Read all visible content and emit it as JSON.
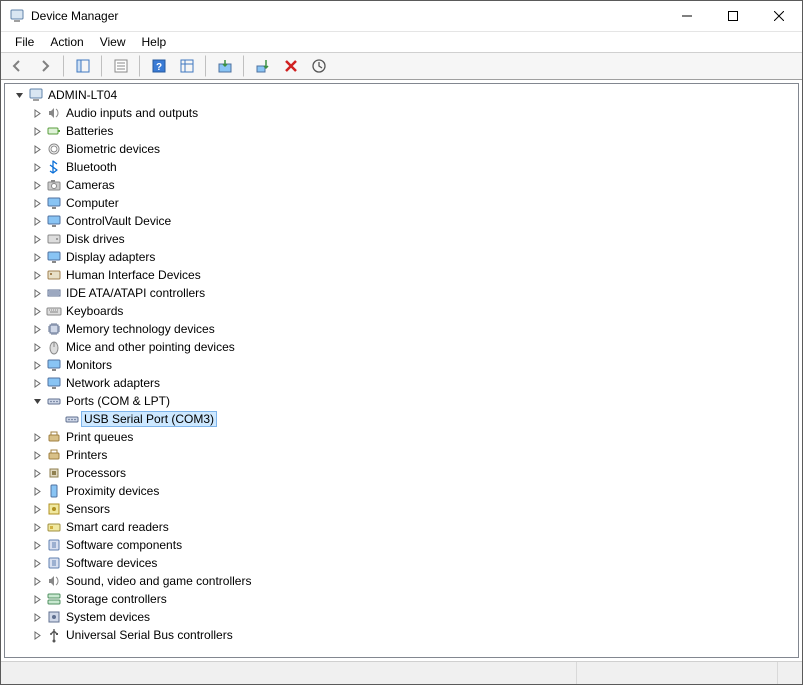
{
  "window": {
    "title": "Device Manager"
  },
  "menu": {
    "file": "File",
    "action": "Action",
    "view": "View",
    "help": "Help"
  },
  "root": {
    "name": "ADMIN-LT04"
  },
  "categories": [
    {
      "id": "audio",
      "label": "Audio inputs and outputs",
      "icon": "speaker"
    },
    {
      "id": "batteries",
      "label": "Batteries",
      "icon": "battery"
    },
    {
      "id": "biometric",
      "label": "Biometric devices",
      "icon": "fingerprint"
    },
    {
      "id": "bluetooth",
      "label": "Bluetooth",
      "icon": "bluetooth"
    },
    {
      "id": "cameras",
      "label": "Cameras",
      "icon": "camera"
    },
    {
      "id": "computer",
      "label": "Computer",
      "icon": "monitor"
    },
    {
      "id": "cvault",
      "label": "ControlVault Device",
      "icon": "monitor"
    },
    {
      "id": "disk",
      "label": "Disk drives",
      "icon": "disk"
    },
    {
      "id": "display",
      "label": "Display adapters",
      "icon": "monitor"
    },
    {
      "id": "hid",
      "label": "Human Interface Devices",
      "icon": "hid"
    },
    {
      "id": "ide",
      "label": "IDE ATA/ATAPI controllers",
      "icon": "ide"
    },
    {
      "id": "keyboards",
      "label": "Keyboards",
      "icon": "keyboard"
    },
    {
      "id": "memory",
      "label": "Memory technology devices",
      "icon": "chip"
    },
    {
      "id": "mice",
      "label": "Mice and other pointing devices",
      "icon": "mouse"
    },
    {
      "id": "monitors",
      "label": "Monitors",
      "icon": "monitor"
    },
    {
      "id": "network",
      "label": "Network adapters",
      "icon": "monitor"
    },
    {
      "id": "ports",
      "label": "Ports (COM & LPT)",
      "icon": "port",
      "expanded": true,
      "children": [
        {
          "id": "usbserial",
          "label": "USB Serial Port (COM3)",
          "icon": "port",
          "selected": true
        }
      ]
    },
    {
      "id": "printq",
      "label": "Print queues",
      "icon": "printer"
    },
    {
      "id": "printers",
      "label": "Printers",
      "icon": "printer"
    },
    {
      "id": "cpu",
      "label": "Processors",
      "icon": "cpu"
    },
    {
      "id": "proximity",
      "label": "Proximity devices",
      "icon": "phone"
    },
    {
      "id": "sensors",
      "label": "Sensors",
      "icon": "sensor"
    },
    {
      "id": "smartcard",
      "label": "Smart card readers",
      "icon": "card"
    },
    {
      "id": "swcomp",
      "label": "Software components",
      "icon": "software"
    },
    {
      "id": "swdev",
      "label": "Software devices",
      "icon": "software"
    },
    {
      "id": "sound",
      "label": "Sound, video and game controllers",
      "icon": "speaker"
    },
    {
      "id": "storage",
      "label": "Storage controllers",
      "icon": "storage"
    },
    {
      "id": "system",
      "label": "System devices",
      "icon": "system"
    },
    {
      "id": "usb",
      "label": "Universal Serial Bus controllers",
      "icon": "usb"
    }
  ]
}
